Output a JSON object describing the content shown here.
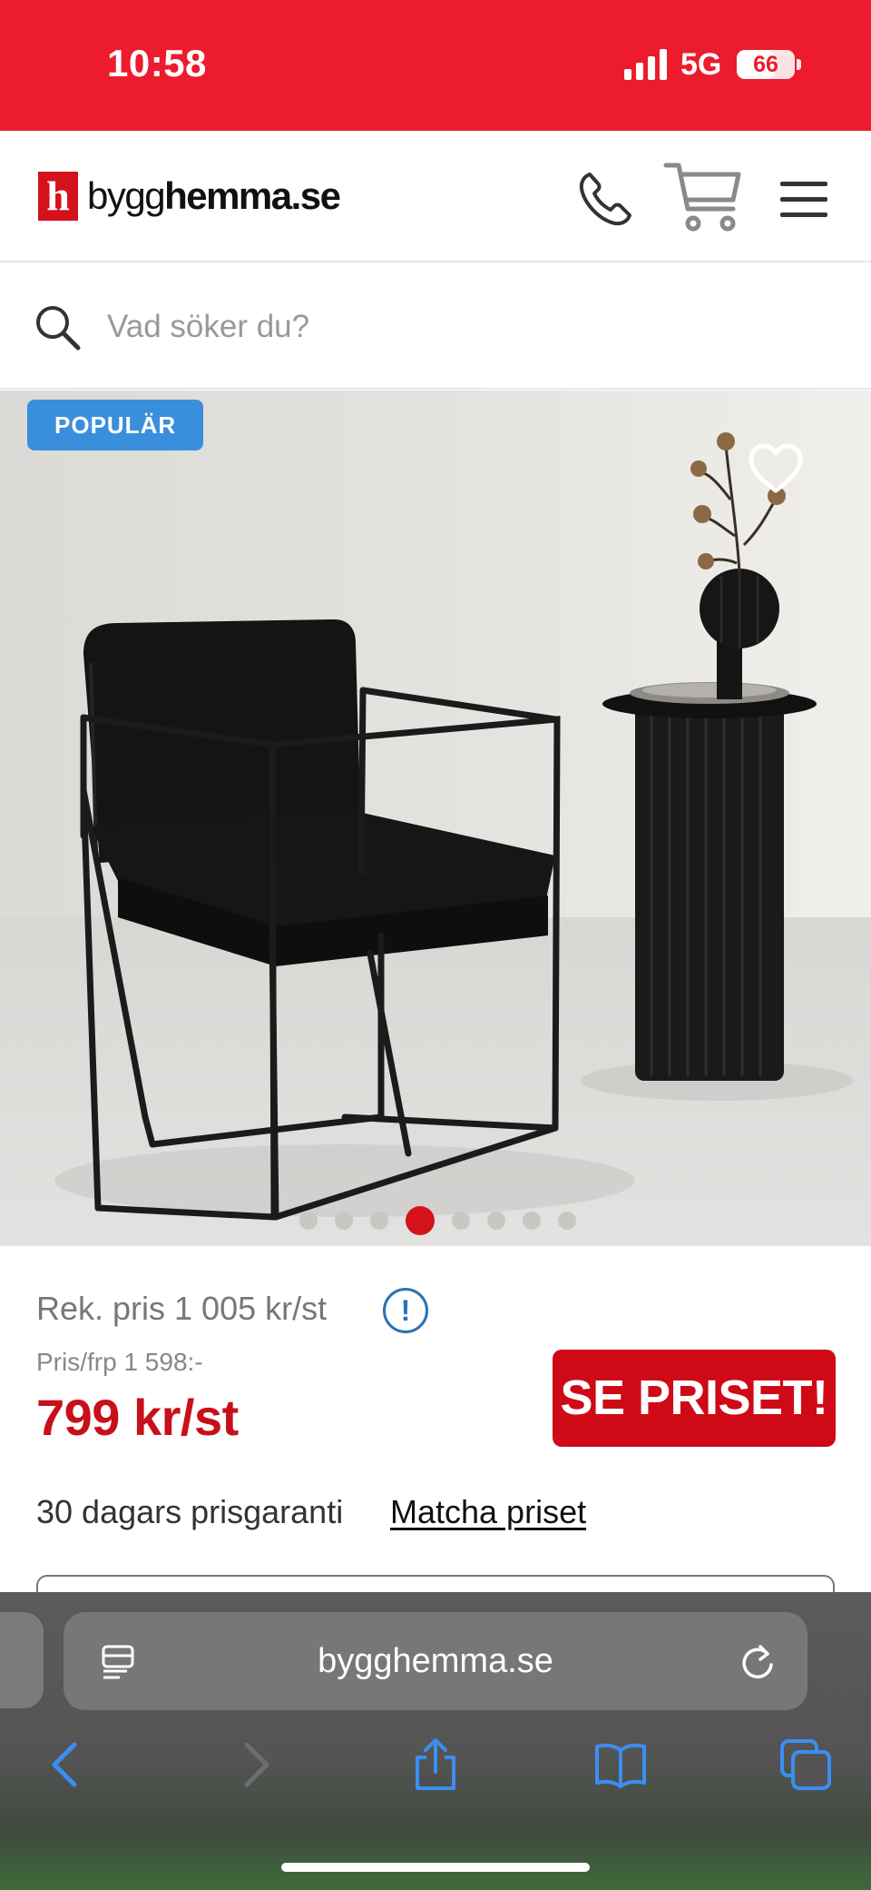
{
  "status_bar": {
    "time": "10:58",
    "network": "5G",
    "battery": "66",
    "battery_level": 0.66
  },
  "header": {
    "logo_mark": "h",
    "logo_text_light": "bygg",
    "logo_text_bold": "hemma.se",
    "icons": [
      "phone-icon",
      "cart-icon",
      "hamburger-menu-icon"
    ]
  },
  "search": {
    "placeholder": "Vad söker du?"
  },
  "product": {
    "badge": "POPULÄR",
    "image_count": 8,
    "active_image_index": 3,
    "rek_price": "Rek. pris 1 005 kr/st",
    "info_icon_glyph": "!",
    "old_price": "Pris/frp 1 598:-",
    "price": "799 kr/st",
    "cta_label": "SE PRISET!",
    "guarantee_text": "30 dagars prisgaranti",
    "match_link": "Matcha priset"
  },
  "browser": {
    "url": "bygghemma.se",
    "toolbar_icons": [
      "back-icon",
      "forward-icon",
      "share-icon",
      "bookmarks-icon",
      "tabs-icon"
    ]
  },
  "colors": {
    "brand_red": "#ec1b2d",
    "price_red": "#c8101a",
    "badge_blue": "#3a8fdc",
    "safari_blue": "#3b8ef3"
  }
}
